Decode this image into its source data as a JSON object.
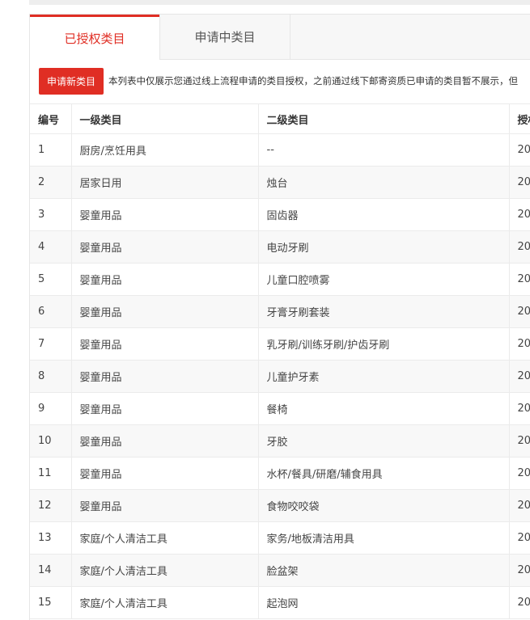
{
  "tabs": [
    {
      "label": "已授权类目",
      "active": true
    },
    {
      "label": "申请中类目",
      "active": false
    }
  ],
  "apply_button": "申请新类目",
  "notice": "本列表中仅展示您通过线上流程申请的类目授权，之前通过线下邮寄资质已申请的类目暂不展示，但",
  "table": {
    "headers": [
      "编号",
      "一级类目",
      "二级类目",
      "授权"
    ],
    "rows": [
      [
        "1",
        "厨房/烹饪用具",
        "--",
        "20"
      ],
      [
        "2",
        "居家日用",
        "烛台",
        "20"
      ],
      [
        "3",
        "婴童用品",
        "固齿器",
        "20"
      ],
      [
        "4",
        "婴童用品",
        "电动牙刷",
        "20"
      ],
      [
        "5",
        "婴童用品",
        "儿童口腔喷雾",
        "20"
      ],
      [
        "6",
        "婴童用品",
        "牙膏牙刷套装",
        "20"
      ],
      [
        "7",
        "婴童用品",
        "乳牙刷/训练牙刷/护齿牙刷",
        "20"
      ],
      [
        "8",
        "婴童用品",
        "儿童护牙素",
        "20"
      ],
      [
        "9",
        "婴童用品",
        "餐椅",
        "20"
      ],
      [
        "10",
        "婴童用品",
        "牙胶",
        "20"
      ],
      [
        "11",
        "婴童用品",
        "水杯/餐具/研磨/辅食用具",
        "20"
      ],
      [
        "12",
        "婴童用品",
        "食物咬咬袋",
        "20"
      ],
      [
        "13",
        "家庭/个人清洁工具",
        "家务/地板清洁用具",
        "20"
      ],
      [
        "14",
        "家庭/个人清洁工具",
        "脸盆架",
        "20"
      ],
      [
        "15",
        "家庭/个人清洁工具",
        "起泡网",
        "20"
      ]
    ]
  },
  "colors": {
    "accent": "#e02e24"
  }
}
